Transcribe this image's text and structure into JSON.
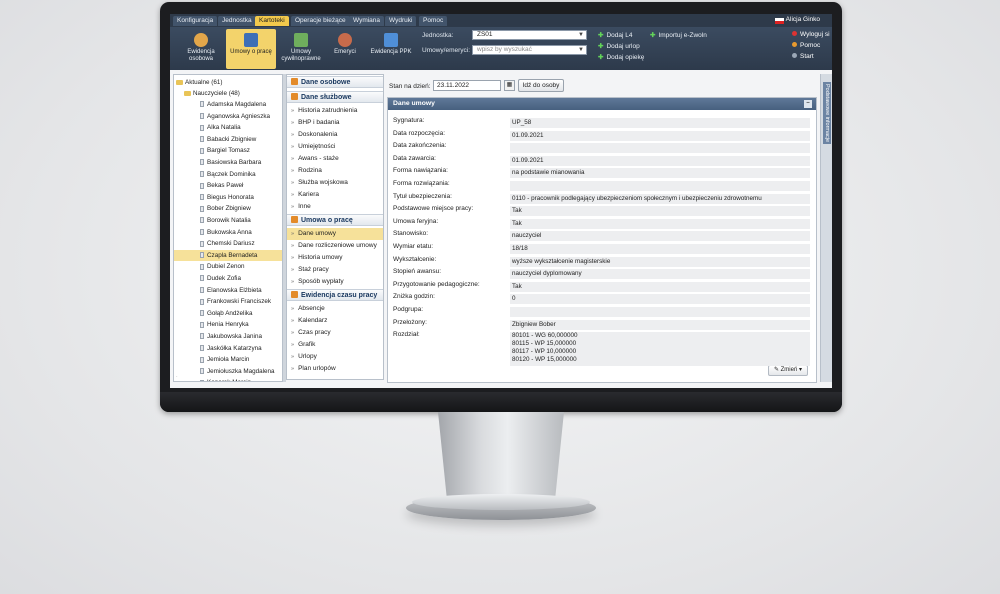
{
  "menu": {
    "items": [
      "Konfiguracja",
      "Jednostka",
      "Kartoteki",
      "Operacje bieżące",
      "Wymiana",
      "Wydruki",
      "Pomoc"
    ],
    "active_index": 2,
    "user": "Alicja Ginko"
  },
  "toolbar": {
    "buttons": [
      "Ewidencja osobowa",
      "Umowy o pracę",
      "Umowy cywilnoprawne",
      "Emeryci",
      "Ewidencja PPK"
    ],
    "active_index": 1,
    "jednostka_label": "Jednostka:",
    "jednostka_value": "ZS01",
    "umowy_label": "Umowy/emeryci:",
    "umowy_placeholder": "wpisz by wyszukać",
    "actions": [
      "Dodaj L4",
      "Dodaj urlop",
      "Dodaj opiekę",
      "Importuj e-Zwoln"
    ],
    "right_actions": [
      "Wyloguj si",
      "Pomoc",
      "Start"
    ]
  },
  "tree": {
    "root": "Aktualne (61)",
    "group": "Nauczyciele (48)",
    "people": [
      "Adamska Magdalena",
      "Aganowska Agnieszka",
      "Alka Natalia",
      "Babacki Zbigniew",
      "Bargiel Tomasz",
      "Basiowska Barbara",
      "Bączek Dominika",
      "Bekas Paweł",
      "Biegus Honorata",
      "Bober Zbigniew",
      "Borowik Natalia",
      "Bukowska Anna",
      "Chemski Dariusz",
      "Czapla Bernadeta",
      "Dubiel Zenon",
      "Dudek Zofia",
      "Elanowska Elżbieta",
      "Frankowski Franciszek",
      "Gołąb Andżelika",
      "Henia Henryka",
      "Jakubowska Janina",
      "Jaskółka Katarzyna",
      "Jemioła Marcin",
      "Jemiołuszka Magdalena",
      "Kanarek Marcin"
    ],
    "selected_index": 13
  },
  "nav": {
    "sections": [
      {
        "title": "Dane osobowe",
        "items": []
      },
      {
        "title": "Dane służbowe",
        "items": [
          "Historia zatrudnienia",
          "BHP i badania",
          "Doskonalenia",
          "Umiejętności",
          "Awans - staże",
          "Rodzina",
          "Służba wojskowa",
          "Kariera",
          "Inne"
        ]
      },
      {
        "title": "Umowa o pracę",
        "items": [
          "Dane umowy",
          "Dane rozliczeniowe umowy",
          "Historia umowy",
          "Staż pracy",
          "Sposób wypłaty"
        ]
      },
      {
        "title": "Ewidencja czasu pracy",
        "items": [
          "Absencje",
          "Kalendarz",
          "Czas pracy",
          "Grafik",
          "Urlopy",
          "Plan urlopów"
        ]
      }
    ],
    "selected_item": "Dane umowy"
  },
  "main": {
    "stan_label": "Stan na dzień:",
    "stan_value": "23.11.2022",
    "goto_button": "Idź do osoby",
    "panel_title": "Dane umowy",
    "fields": [
      {
        "label": "Sygnatura:",
        "value": "UP_58"
      },
      {
        "label": "Data rozpoczęcia:",
        "value": "01.09.2021"
      },
      {
        "label": "Data zakończenia:",
        "value": ""
      },
      {
        "label": "Data zawarcia:",
        "value": "01.09.2021"
      },
      {
        "label": "Forma nawiązania:",
        "value": "na podstawie mianowania"
      },
      {
        "label": "Forma rozwiązania:",
        "value": ""
      },
      {
        "label": "Tytuł ubezpieczenia:",
        "value": "0110 - pracownik podlegający ubezpieczeniom społecznym i ubezpieczeniu zdrowotnemu"
      },
      {
        "label": "Podstawowe miejsce pracy:",
        "value": "Tak"
      },
      {
        "label": "Umowa feryjna:",
        "value": "Tak"
      },
      {
        "label": "Stanowisko:",
        "value": "nauczyciel"
      },
      {
        "label": "Wymiar etatu:",
        "value": "18/18"
      },
      {
        "label": "Wykształcenie:",
        "value": "wyższe wykształcenie magisterskie"
      },
      {
        "label": "Stopień awansu:",
        "value": "nauczyciel dyplomowany"
      },
      {
        "label": "Przygotowanie pedagogiczne:",
        "value": "Tak"
      },
      {
        "label": "Zniżka godzin:",
        "value": "0"
      },
      {
        "label": "Podgrupa:",
        "value": ""
      },
      {
        "label": "Przełożony:",
        "value": "Zbigniew Bober"
      },
      {
        "label": "Rozdział:",
        "value": "80101 - WG 60,000000\n80115 - WP 15,000000\n80117 - WP 10,000000\n80120 - WP 15,000000"
      }
    ],
    "zmien_button": "Zmień"
  },
  "colors": {
    "accent": "#f2c94c",
    "header": "#2e3a4a",
    "panel_head": "#47607f"
  }
}
